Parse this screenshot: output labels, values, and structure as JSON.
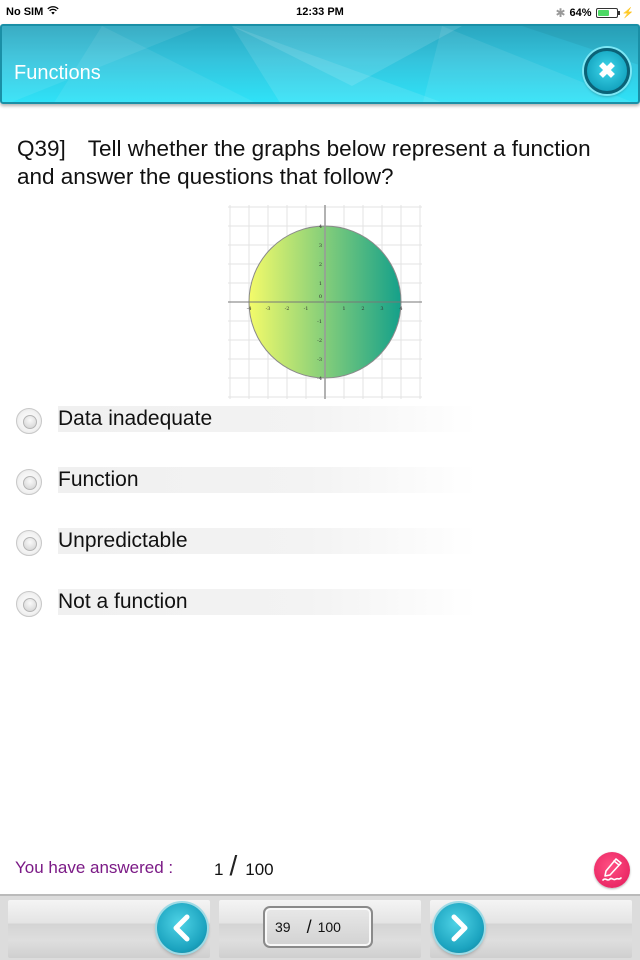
{
  "status_bar": {
    "carrier": "No SIM",
    "time": "12:33 PM",
    "battery_percent_label": "64%",
    "battery_level": 0.64
  },
  "header": {
    "title": "Functions",
    "close_icon": "close-icon"
  },
  "question": {
    "number": "Q39]",
    "text": "Tell whether the graphs below represent a function and answer the questions that follow?"
  },
  "graph": {
    "description": "Circle centered at origin with radius 4, gradient fill yellow to teal",
    "x_ticks": [
      "-4",
      "-3",
      "-2",
      "-1",
      "1",
      "2",
      "3",
      "4"
    ],
    "y_ticks": [
      "4",
      "3",
      "2",
      "1",
      "0",
      "-1",
      "-2",
      "-3",
      "-4"
    ],
    "circle_radius": 4,
    "colors": {
      "fill_start": "#f4fb6a",
      "fill_end": "#14a08a",
      "stroke": "#8a8a8a"
    }
  },
  "options": [
    {
      "label": "Data inadequate",
      "selected": false
    },
    {
      "label": "Function",
      "selected": false
    },
    {
      "label": "Unpredictable",
      "selected": false
    },
    {
      "label": "Not a function",
      "selected": false
    }
  ],
  "progress": {
    "label": "You have answered :",
    "answered": "1",
    "separator": "/",
    "total": "100"
  },
  "navigation": {
    "current_page": "39",
    "separator": "/",
    "total_pages": "100"
  },
  "colors": {
    "header_accent": "#2fc8e0",
    "answered_label": "#7b1a86",
    "pen_button": "#e2195a"
  }
}
